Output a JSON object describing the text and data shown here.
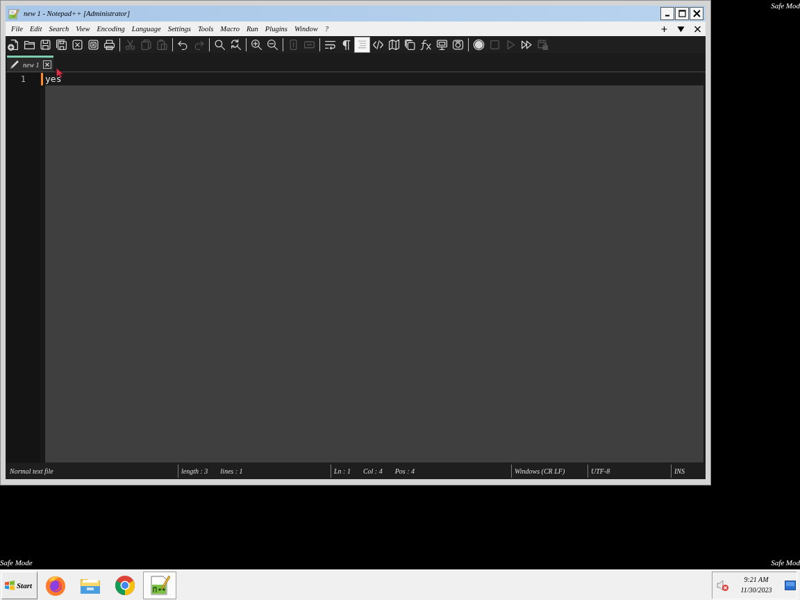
{
  "window": {
    "title": "new 1 - Notepad++ [Administrator]"
  },
  "menu": {
    "items": [
      "File",
      "Edit",
      "Search",
      "View",
      "Encoding",
      "Language",
      "Settings",
      "Tools",
      "Macro",
      "Run",
      "Plugins",
      "Window",
      "?"
    ]
  },
  "toolbar": [
    {
      "buttons": [
        {
          "kind": "new",
          "disabled": false,
          "pressed": false
        },
        {
          "kind": "open",
          "disabled": false,
          "pressed": false
        },
        {
          "kind": "save",
          "disabled": false,
          "pressed": false
        },
        {
          "kind": "save_all",
          "disabled": false,
          "pressed": false
        },
        {
          "kind": "close",
          "disabled": false,
          "pressed": false
        },
        {
          "kind": "close_all",
          "disabled": false,
          "pressed": false
        },
        {
          "kind": "print",
          "disabled": false,
          "pressed": false
        }
      ]
    },
    {
      "buttons": [
        {
          "kind": "cut",
          "disabled": true,
          "pressed": false
        },
        {
          "kind": "copy",
          "disabled": true,
          "pressed": false
        },
        {
          "kind": "paste",
          "disabled": true,
          "pressed": false
        }
      ]
    },
    {
      "buttons": [
        {
          "kind": "undo",
          "disabled": false,
          "pressed": false
        },
        {
          "kind": "redo",
          "disabled": true,
          "pressed": false
        }
      ]
    },
    {
      "buttons": [
        {
          "kind": "find",
          "disabled": false,
          "pressed": false
        },
        {
          "kind": "replace",
          "disabled": false,
          "pressed": false
        }
      ]
    },
    {
      "buttons": [
        {
          "kind": "zoom_in",
          "disabled": false,
          "pressed": false
        },
        {
          "kind": "zoom_out",
          "disabled": false,
          "pressed": false
        }
      ]
    },
    {
      "buttons": [
        {
          "kind": "sync_vertical",
          "disabled": true,
          "pressed": false
        },
        {
          "kind": "sync_horizontal",
          "disabled": true,
          "pressed": false
        }
      ]
    },
    {
      "buttons": [
        {
          "kind": "wrap",
          "disabled": false,
          "pressed": false
        },
        {
          "kind": "all_chars",
          "disabled": false,
          "pressed": false
        },
        {
          "kind": "indent_guide",
          "disabled": false,
          "pressed": true
        },
        {
          "kind": "code",
          "disabled": false,
          "pressed": false
        },
        {
          "kind": "doc_map",
          "disabled": false,
          "pressed": false
        },
        {
          "kind": "doc_list",
          "disabled": false,
          "pressed": false
        },
        {
          "kind": "function_list",
          "disabled": false,
          "pressed": false
        },
        {
          "kind": "workspace",
          "disabled": false,
          "pressed": false
        },
        {
          "kind": "monitoring",
          "disabled": false,
          "pressed": false
        }
      ]
    },
    {
      "buttons": [
        {
          "kind": "record",
          "disabled": false,
          "pressed": false
        },
        {
          "kind": "stop",
          "disabled": true,
          "pressed": false
        },
        {
          "kind": "play",
          "disabled": true,
          "pressed": false
        },
        {
          "kind": "play_multiple",
          "disabled": false,
          "pressed": false
        },
        {
          "kind": "save_macro",
          "disabled": true,
          "pressed": false
        }
      ]
    }
  ],
  "tabs": [
    {
      "label": "new 1",
      "selected": true
    }
  ],
  "editor": {
    "lines": [
      {
        "number": "1",
        "text": "yes",
        "current": true,
        "modified": true
      }
    ]
  },
  "status_bar": {
    "sections": [
      {
        "items": [
          "Normal text file"
        ]
      },
      {
        "items": [
          "length : 3",
          "lines : 1"
        ]
      },
      {
        "items": [
          "Ln : 1",
          "Col : 4",
          "Pos : 4"
        ]
      },
      {
        "items": [
          "Windows (CR LF)"
        ]
      },
      {
        "items": [
          "UTF-8"
        ]
      },
      {
        "items": [
          "INS"
        ]
      }
    ]
  },
  "desktop": {
    "top_right_label": "Safe Mod",
    "bottom_left_label": "Safe Mode",
    "bottom_right_label": "Safe Mod"
  },
  "taskbar": {
    "start": "Start",
    "apps": [
      {
        "kind": "fox_browser",
        "selected": false
      },
      {
        "kind": "files",
        "selected": false
      },
      {
        "kind": "round_browser",
        "selected": false
      },
      {
        "kind": "notepad",
        "selected": true
      }
    ],
    "tray": {
      "muted": true,
      "time": "9:21 AM",
      "date": "11/30/2023"
    }
  }
}
